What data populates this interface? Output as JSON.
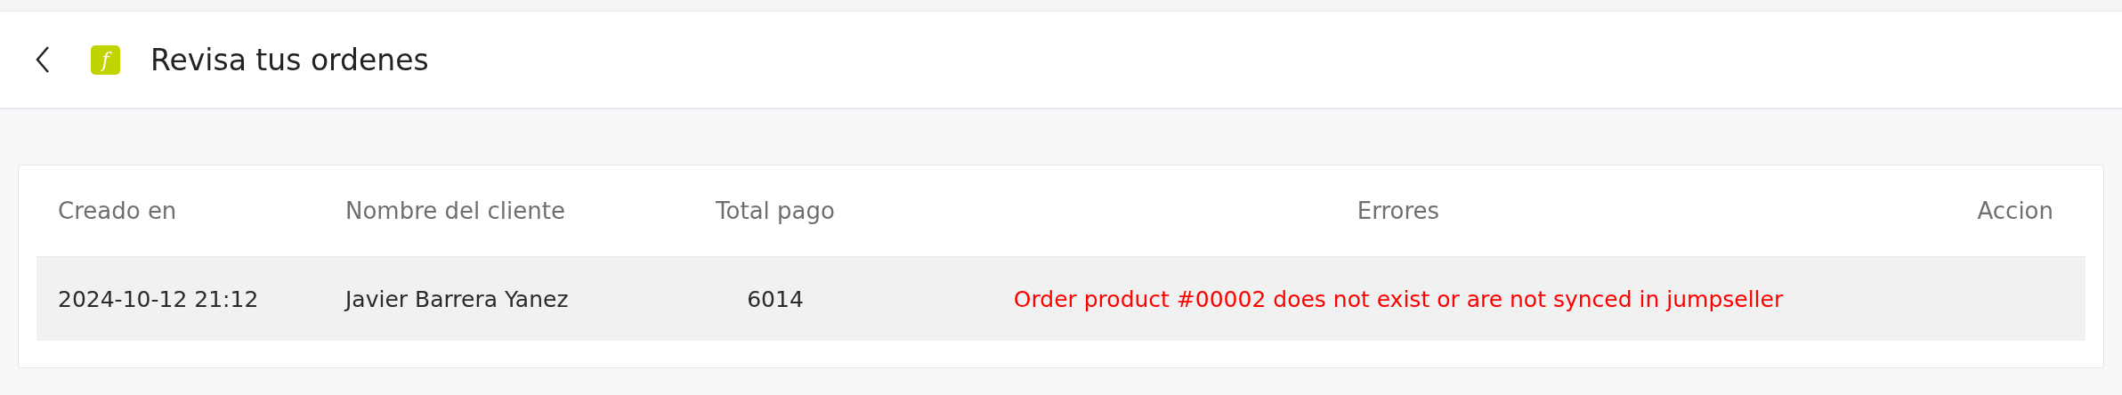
{
  "header": {
    "logo": "f",
    "title": "Revisa tus ordenes"
  },
  "table": {
    "columns": [
      "Creado en",
      "Nombre del cliente",
      "Total pago",
      "Errores",
      "Accion"
    ],
    "rows": [
      {
        "cells": [
          "2024-10-12 21:12",
          "Javier Barrera Yanez",
          "6014",
          "Order product #00002 does not exist or are not synced in jumpseller"
        ],
        "has_error": true
      }
    ]
  }
}
